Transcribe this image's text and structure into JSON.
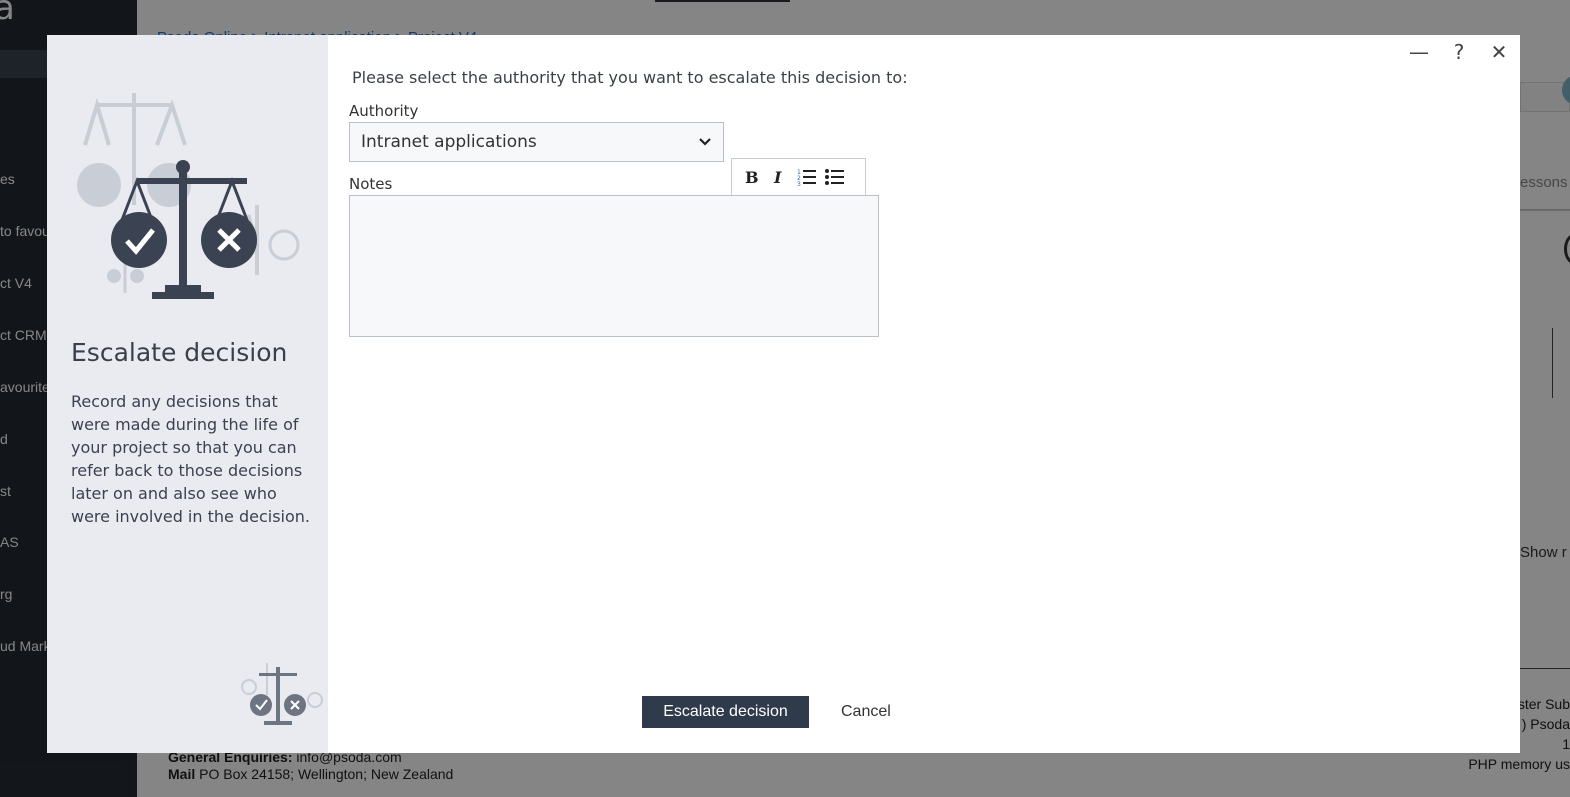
{
  "background": {
    "logo": "a",
    "breadcrumb": "Psoda Online > Intranet application > Project V4",
    "sidebar_items": [
      "es",
      "to favourites",
      "ct V4",
      "ct CRM",
      "avourites",
      "d",
      "st",
      "AS",
      "rg",
      "ud Market"
    ],
    "right_partial": {
      "lessons": "essons",
      "show": "Show r"
    },
    "footer": {
      "enquiries_label": "General Enquiries:",
      "enquiries_value": "info@psoda.com",
      "mail_label": "Mail",
      "mail_value": "PO Box 24158; Wellington; New Zealand"
    },
    "footer_right": [
      "ster Sub",
      ") Psoda",
      "1",
      "PHP memory us"
    ]
  },
  "modal": {
    "title": "Escalate decision",
    "description": "Record any decisions that were made during the life of your project so that you can refer back to those decisions later on and also see who were involved in the decision.",
    "window_controls": {
      "minimize": "—",
      "help": "?",
      "close": "✕"
    },
    "prompt": "Please select the authority that you want to escalate this decision to:",
    "authority": {
      "label": "Authority",
      "value": "Intranet applications"
    },
    "notes": {
      "label": "Notes",
      "value": "",
      "toolbar": [
        "bold-icon",
        "italic-icon",
        "ordered-list-icon",
        "bullet-list-icon"
      ]
    },
    "buttons": {
      "escalate": "Escalate decision",
      "cancel": "Cancel"
    },
    "colors": {
      "primary_button": "#2f3a4b",
      "aside_bg": "#e9ebf0",
      "illustration": "#3b4252"
    }
  }
}
